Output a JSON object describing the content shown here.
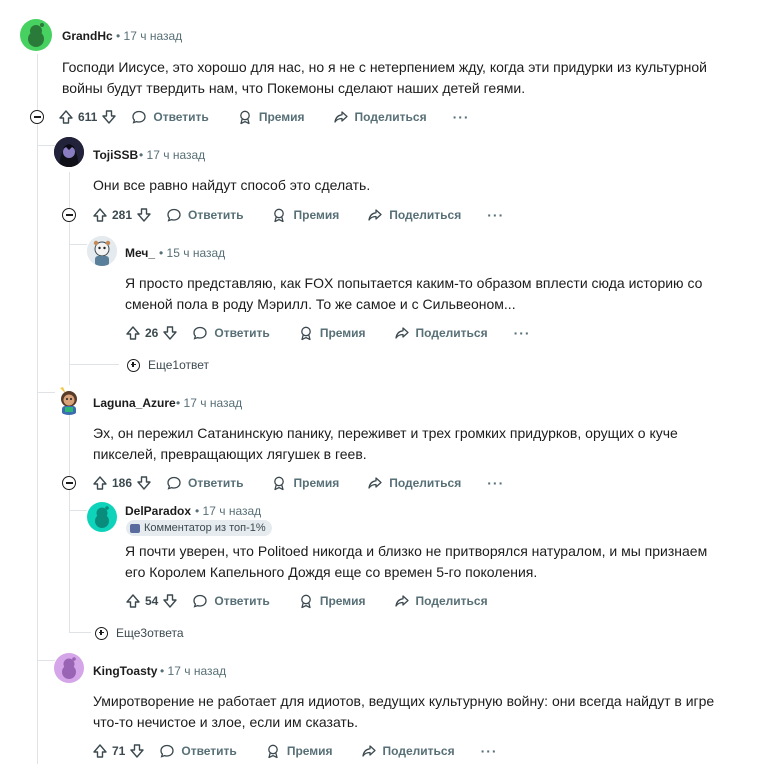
{
  "comments": [
    {
      "id": "c1",
      "author": "GrandHc",
      "time": "17 ч назад",
      "text": "Господи Иисусе, это хорошо для нас, но я не с нетерпением жду, когда эти придурки из культурной войны будут твердить нам, что Покемоны сделают наших детей геями.",
      "score": "611",
      "avatar_color": "#46d160"
    },
    {
      "id": "c2",
      "author": "TojiSSB",
      "time": "17 ч назад",
      "text": "Они все равно найдут способ это сделать.",
      "score": "281",
      "avatar_color": "#1a1a2e"
    },
    {
      "id": "c3",
      "author": "Меч_",
      "time": "15 ч назад",
      "text": "Я просто представляю, как FOX попытается каким-то образом вплести сюда историю со сменой пола в роду Мэрилл. То же самое и с Сильвеоном...",
      "score": "26",
      "avatar_color": "#dce3e8",
      "more_replies": "Еще1ответ"
    },
    {
      "id": "c4",
      "author": "Laguna_Azure",
      "time": "17 ч назад",
      "text": "Эх, он пережил Сатанинскую панику, переживет и трех громких придурков, орущих о куче пикселей, превращающих лягушек в геев.",
      "score": "186",
      "avatar_color": "#f2c94c"
    },
    {
      "id": "c5",
      "author": "DelParadox",
      "time": "17 ч назад",
      "flair": "Комментатор из топ-1%",
      "text": "Я почти уверен, что Politoed никогда и близко не притворялся натуралом, и мы признаем его Королем Капельного Дождя еще со времен 5-го поколения.",
      "score": "54",
      "avatar_color": "#0dd3bb",
      "more_replies": "Еще3ответа"
    },
    {
      "id": "c6",
      "author": "KingToasty",
      "time": "17 ч назад",
      "text": "Умиротворение не работает для идиотов, ведущих культурную войну: они всегда найдут в игре что-то нечистое и злое, если им сказать.",
      "score": "71",
      "avatar_color": "#d4a5e8"
    }
  ],
  "labels": {
    "reply": "Ответить",
    "award": "Премия",
    "share": "Поделиться",
    "more": "···",
    "separator": "•"
  },
  "colors": {
    "text": "#1c1c1c",
    "meta": "#576f76",
    "thread_line": "#dfe3e6"
  }
}
